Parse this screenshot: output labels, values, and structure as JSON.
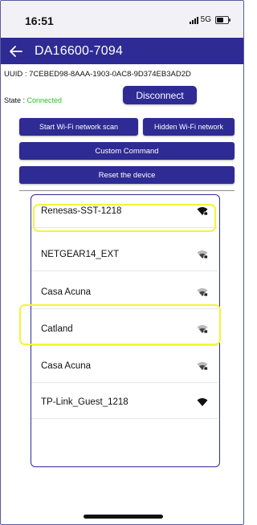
{
  "status_bar": {
    "time": "16:51",
    "network": "5G"
  },
  "app_bar": {
    "title": "DA16600-7094"
  },
  "device": {
    "uuid_label": "UUID :",
    "uuid": "7CEBED98-8AAA-1903-0AC8-9D374EB3AD2D",
    "state_label": "State :",
    "state_value": "Connected"
  },
  "buttons": {
    "disconnect": "Disconnect",
    "scan": "Start Wi-Fi network scan",
    "hidden": "Hidden Wi-Fi network",
    "custom": "Custom Command",
    "reset": "Reset the device"
  },
  "networks": [
    {
      "ssid": "Renesas-SST-1218",
      "secured": true,
      "strength": "strong",
      "highlighted": true
    },
    {
      "ssid": "NETGEAR14_EXT",
      "secured": true,
      "strength": "medium",
      "highlighted": false
    },
    {
      "ssid": "Casa Acuna",
      "secured": true,
      "strength": "medium",
      "highlighted": false
    },
    {
      "ssid": "Catland",
      "secured": true,
      "strength": "medium",
      "highlighted": true
    },
    {
      "ssid": "Casa Acuna",
      "secured": true,
      "strength": "medium",
      "highlighted": false
    },
    {
      "ssid": "TP-Link_Guest_1218",
      "secured": false,
      "strength": "strong",
      "highlighted": false
    }
  ],
  "colors": {
    "primary": "#2e2b94",
    "connected": "#26c426",
    "highlight": "#f4f43a"
  },
  "icons": {
    "back": "arrow-left-icon",
    "wifi": "wifi-icon",
    "signal": "cellular-signal-icon",
    "battery": "battery-icon"
  }
}
